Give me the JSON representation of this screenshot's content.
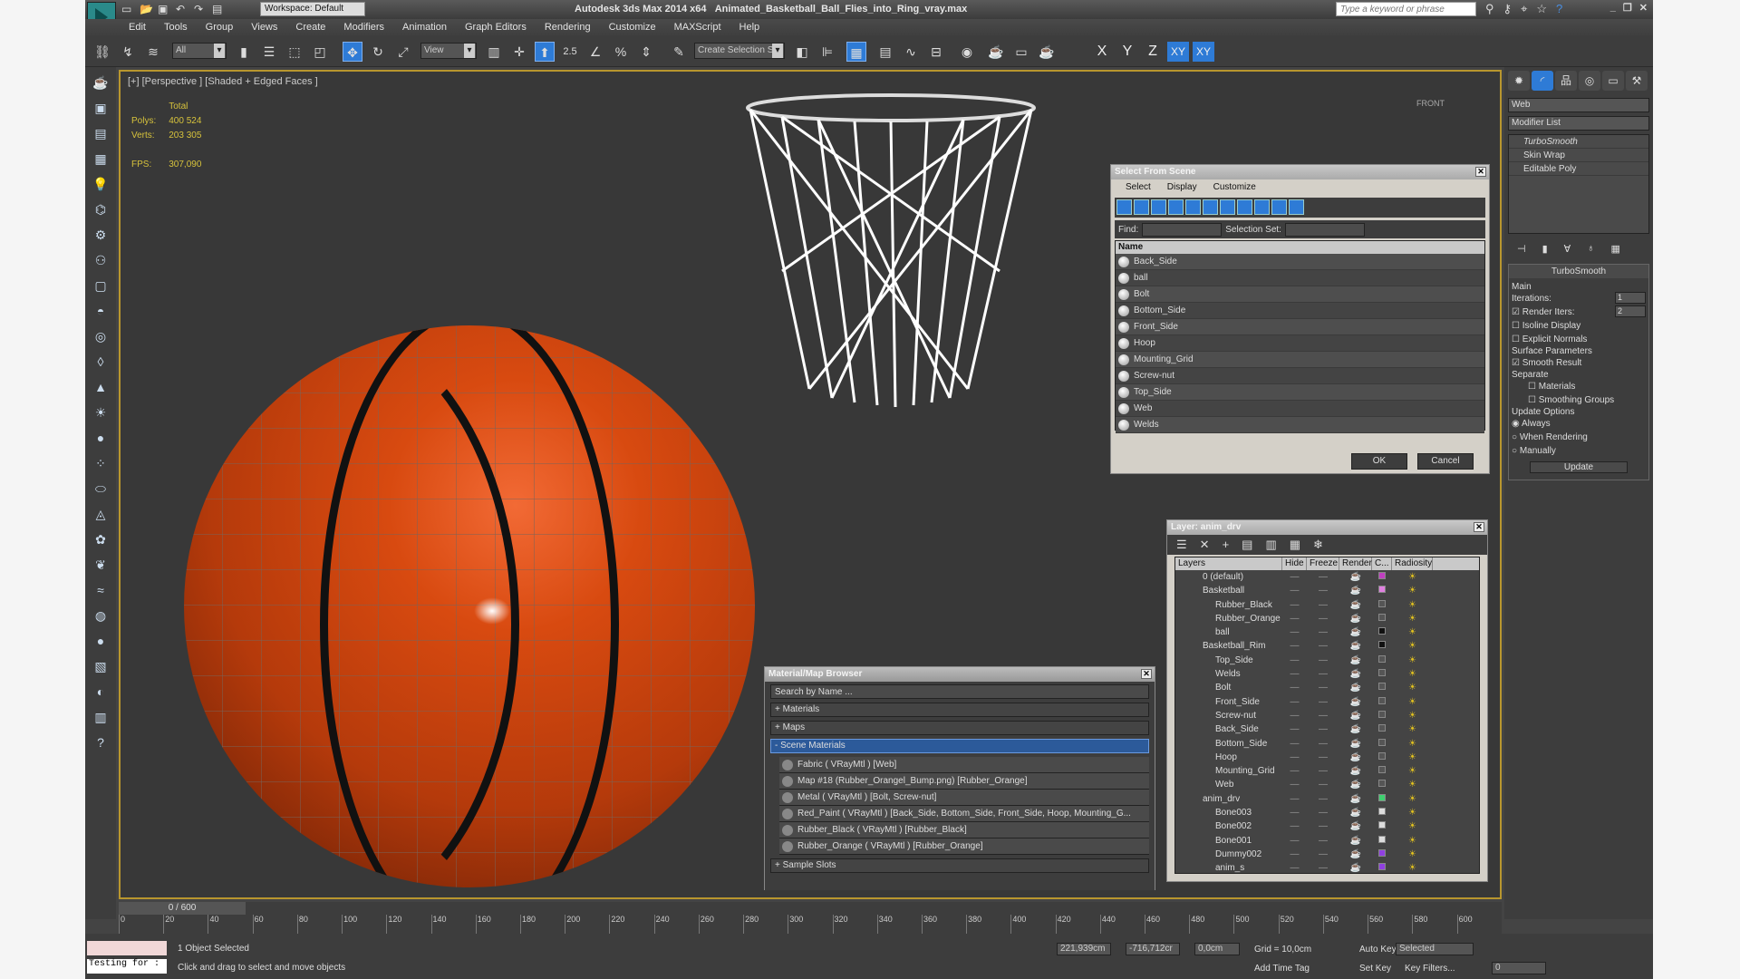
{
  "titlebar": {
    "app_title": "Autodesk 3ds Max  2014 x64",
    "file_name": "Animated_Basketball_Ball_Flies_into_Ring_vray.max",
    "workspace": "Workspace: Default",
    "search_placeholder": "Type a keyword or phrase"
  },
  "menu": [
    "Edit",
    "Tools",
    "Group",
    "Views",
    "Create",
    "Modifiers",
    "Animation",
    "Graph Editors",
    "Rendering",
    "Customize",
    "MAXScript",
    "Help"
  ],
  "toolbar": {
    "selection_filter": "All",
    "ref_coord": "View",
    "snap_angle": "2.5",
    "named_selection": "Create Selection Se",
    "axis": [
      "X",
      "Y",
      "Z",
      "XY",
      "XY"
    ]
  },
  "viewport": {
    "label": "[+] [Perspective ] [Shaded + Edged Faces ]",
    "stats_header": "Total",
    "polys_label": "Polys:",
    "polys": "400 524",
    "verts_label": "Verts:",
    "verts": "203 305",
    "fps_label": "FPS:",
    "fps": "307,090",
    "viewcube": "FRONT"
  },
  "select_from_scene": {
    "title": "Select From Scene",
    "menu": [
      "Select",
      "Display",
      "Customize"
    ],
    "find_label": "Find:",
    "selection_set_label": "Selection Set:",
    "column": "Name",
    "items": [
      "Back_Side",
      "ball",
      "Bolt",
      "Bottom_Side",
      "Front_Side",
      "Hoop",
      "Mounting_Grid",
      "Screw-nut",
      "Top_Side",
      "Web",
      "Welds"
    ],
    "ok": "OK",
    "cancel": "Cancel"
  },
  "layer_manager": {
    "title": "Layer: anim_drv",
    "columns": [
      "Layers",
      "Hide",
      "Freeze",
      "Render",
      "C...",
      "Radiosity"
    ],
    "rows": [
      {
        "name": "0 (default)",
        "sub": false
      },
      {
        "name": "Basketball",
        "sub": false
      },
      {
        "name": "Rubber_Black",
        "sub": true
      },
      {
        "name": "Rubber_Orange",
        "sub": true
      },
      {
        "name": "ball",
        "sub": true
      },
      {
        "name": "Basketball_Rim",
        "sub": false
      },
      {
        "name": "Top_Side",
        "sub": true
      },
      {
        "name": "Welds",
        "sub": true
      },
      {
        "name": "Bolt",
        "sub": true
      },
      {
        "name": "Front_Side",
        "sub": true
      },
      {
        "name": "Screw-nut",
        "sub": true
      },
      {
        "name": "Back_Side",
        "sub": true
      },
      {
        "name": "Bottom_Side",
        "sub": true
      },
      {
        "name": "Hoop",
        "sub": true
      },
      {
        "name": "Mounting_Grid",
        "sub": true
      },
      {
        "name": "Web",
        "sub": true
      },
      {
        "name": "anim_drv",
        "sub": false
      },
      {
        "name": "Bone003",
        "sub": true
      },
      {
        "name": "Bone002",
        "sub": true
      },
      {
        "name": "Bone001",
        "sub": true
      },
      {
        "name": "Dummy002",
        "sub": true
      },
      {
        "name": "anim_s",
        "sub": true
      }
    ]
  },
  "material_browser": {
    "title": "Material/Map Browser",
    "search_placeholder": "Search by Name ...",
    "groups": [
      "+ Materials",
      "+ Maps",
      "- Scene Materials"
    ],
    "items": [
      "Fabric  ( VRayMtl ) [Web]",
      "Map #18 (Rubber_Orangel_Bump.png) [Rubber_Orange]",
      "Metal  ( VRayMtl ) [Bolt, Screw-nut]",
      "Red_Paint  ( VRayMtl ) [Back_Side, Bottom_Side, Front_Side, Hoop, Mounting_G...",
      "Rubber_Black  ( VRayMtl ) [Rubber_Black]",
      "Rubber_Orange  ( VRayMtl ) [Rubber_Orange]"
    ],
    "sample_slots": "+ Sample Slots"
  },
  "command_panel": {
    "object_name": "Web",
    "modifier_list": "Modifier List",
    "stack": [
      "TurboSmooth",
      "Skin Wrap",
      "Editable Poly"
    ],
    "rollout_title": "TurboSmooth",
    "main_label": "Main",
    "iterations_label": "Iterations:",
    "iterations": "1",
    "render_iters_label": "Render Iters:",
    "render_iters": "2",
    "isoline": "Isoline Display",
    "explicit_normals": "Explicit Normals",
    "surface_params": "Surface Parameters",
    "smooth_result": "Smooth Result",
    "separate": "Separate",
    "materials": "Materials",
    "smoothing_groups": "Smoothing Groups",
    "update_options": "Update Options",
    "always": "Always",
    "when_rendering": "When Rendering",
    "manually": "Manually",
    "update_btn": "Update"
  },
  "timeline": {
    "frame": "0 / 600",
    "ticks": [
      "0",
      "20",
      "40",
      "60",
      "80",
      "100",
      "120",
      "140",
      "160",
      "180",
      "200",
      "220",
      "240",
      "260",
      "280",
      "300",
      "320",
      "340",
      "360",
      "380",
      "400",
      "420",
      "440",
      "460",
      "480",
      "500",
      "520",
      "540",
      "560",
      "580",
      "600"
    ]
  },
  "status": {
    "maxscript": "Testing for :",
    "selected": "1 Object Selected",
    "prompt": "Click and drag to select and move objects",
    "x": "221,939cm",
    "y": "-716,712cr",
    "z": "0,0cm",
    "grid": "Grid = 10,0cm",
    "auto_key": "Auto Key",
    "set_key": "Set Key",
    "selected_mode": "Selected",
    "key_filters": "Key Filters...",
    "add_time_tag": "Add Time Tag",
    "frame": "0"
  }
}
